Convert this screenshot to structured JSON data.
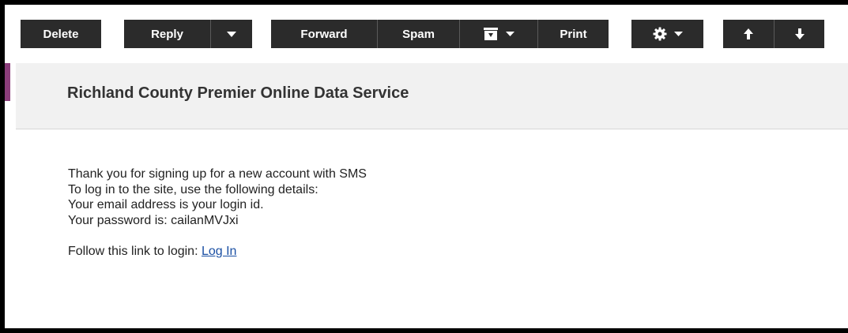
{
  "toolbar": {
    "delete_label": "Delete",
    "reply_label": "Reply",
    "forward_label": "Forward",
    "spam_label": "Spam",
    "print_label": "Print",
    "icons": {
      "reply_dropdown": "chevron-down-icon",
      "move": "archive-box-icon",
      "settings": "gear-icon",
      "previous": "arrow-up-icon",
      "next": "arrow-down-icon"
    }
  },
  "message": {
    "subject": "Richland County Premier Online Data Service",
    "lines": [
      "Thank you for signing up for a new account with SMS",
      "To log in to the site, use the following details:",
      "Your email address is your login id.",
      "Your password is: cailanMVJxi"
    ],
    "follow_text": "Follow this link to login: ",
    "link_text": "Log In"
  },
  "colors": {
    "toolbar_button": "#2b2b2b",
    "header_background": "#f1f1f1",
    "accent": "#8a3d7a",
    "link": "#1a4fa3"
  }
}
